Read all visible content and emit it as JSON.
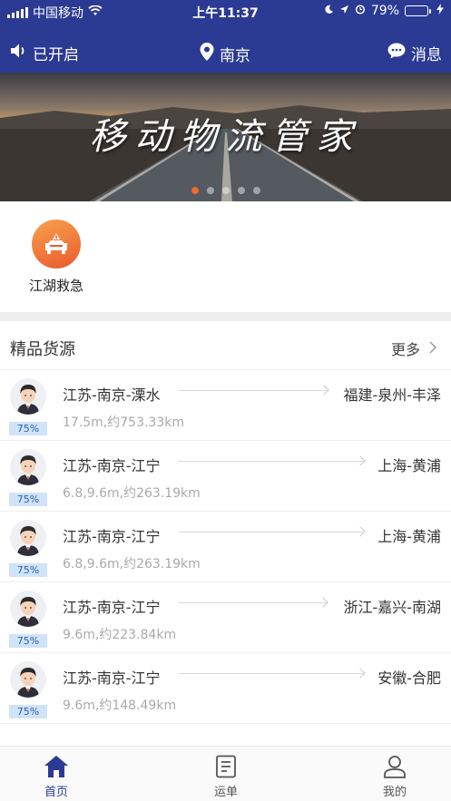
{
  "status_bar": {
    "carrier": "中国移动",
    "time": "上午11:37",
    "battery_percent": "79%",
    "battery_level": 0.79
  },
  "navbar": {
    "voice_label": "已开启",
    "city": "南京",
    "message_label": "消息"
  },
  "banner": {
    "title": "移动物流管家",
    "slide_count": 5,
    "active_slide": 0
  },
  "quick_entries": [
    {
      "label": "江湖救急",
      "icon": "rescue-car-icon"
    }
  ],
  "cargo_section": {
    "title": "精品货源",
    "more_label": "更多"
  },
  "cargo_list": [
    {
      "from": "江苏-南京-溧水",
      "to": "福建-泉州-丰泽",
      "meta": "17.5m,约753.33km",
      "badge": "75%"
    },
    {
      "from": "江苏-南京-江宁",
      "to": "上海-黄浦",
      "meta": "6.8,9.6m,约263.19km",
      "badge": "75%"
    },
    {
      "from": "江苏-南京-江宁",
      "to": "上海-黄浦",
      "meta": "6.8,9.6m,约263.19km",
      "badge": "75%"
    },
    {
      "from": "江苏-南京-江宁",
      "to": "浙江-嘉兴-南湖",
      "meta": "9.6m,约223.84km",
      "badge": "75%"
    },
    {
      "from": "江苏-南京-江宁",
      "to": "安徽-合肥",
      "meta": "9.6m,约148.49km",
      "badge": "75%"
    }
  ],
  "tabbar": {
    "tabs": [
      {
        "label": "首页",
        "icon": "home-icon",
        "active": true
      },
      {
        "label": "运单",
        "icon": "waybill-icon",
        "active": false
      },
      {
        "label": "我的",
        "icon": "profile-icon",
        "active": false
      }
    ]
  },
  "colors": {
    "brand": "#2b3a93",
    "accent": "#f06a2a",
    "badge_bg": "#cfe3f9"
  }
}
